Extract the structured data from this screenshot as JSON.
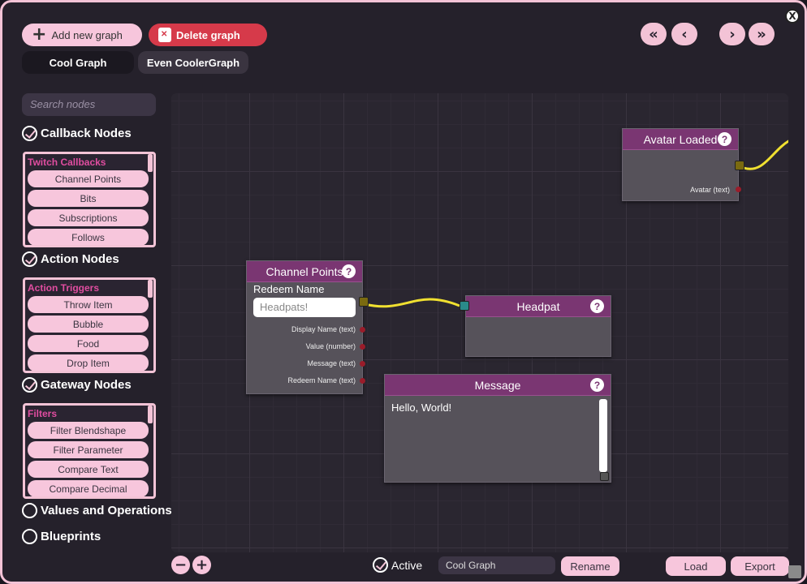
{
  "toolbar": {
    "add_graph_label": "Add new graph",
    "delete_graph_label": "Delete graph",
    "close_label": "X"
  },
  "tabs": [
    {
      "label": "Cool Graph",
      "active": true
    },
    {
      "label": "Even CoolerGraph",
      "active": false
    }
  ],
  "nav": {
    "first": "«",
    "prev": "‹",
    "next": "›",
    "last": "»"
  },
  "sidebar": {
    "search_placeholder": "Search nodes",
    "categories": [
      {
        "label": "Callback Nodes",
        "checked": true,
        "list_title": "Twitch Callbacks",
        "items": [
          "Channel Points",
          "Bits",
          "Subscriptions",
          "Follows"
        ]
      },
      {
        "label": "Action Nodes",
        "checked": true,
        "list_title": "Action Triggers",
        "items": [
          "Throw Item",
          "Bubble",
          "Food",
          "Drop Item"
        ]
      },
      {
        "label": "Gateway Nodes",
        "checked": true,
        "list_title": "Filters",
        "items": [
          "Filter Blendshape",
          "Filter Parameter",
          "Compare Text",
          "Compare Decimal"
        ]
      },
      {
        "label": "Values and Operations",
        "checked": false
      },
      {
        "label": "Blueprints",
        "checked": false
      }
    ]
  },
  "nodes": {
    "avatar_loaded": {
      "title": "Avatar Loaded",
      "outputs": [
        "Avatar (text)"
      ]
    },
    "channel_points": {
      "title": "Channel Points",
      "field_label": "Redeem Name",
      "field_placeholder": "Headpats!",
      "outputs": [
        "Display Name (text)",
        "Value (number)",
        "Message (text)",
        "Redeem Name (text)"
      ]
    },
    "headpat": {
      "title": "Headpat"
    },
    "message": {
      "title": "Message",
      "text": "Hello, World!"
    }
  },
  "footer": {
    "zoom_out": "−",
    "zoom_in": "+",
    "active_label": "Active",
    "active_checked": true,
    "graph_name": "Cool Graph",
    "rename_label": "Rename",
    "load_label": "Load",
    "export_label": "Export"
  },
  "colors": {
    "accent_pink": "#f7c6dc",
    "delete_red": "#d63a4a",
    "node_header": "#7a3672",
    "wire": "#f0e030"
  }
}
